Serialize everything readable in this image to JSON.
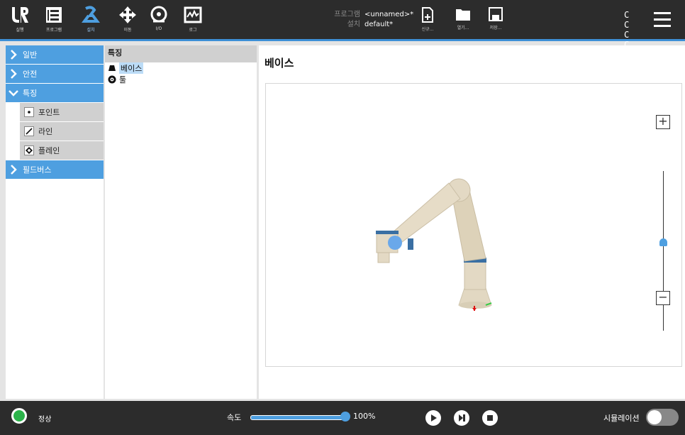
{
  "header": {
    "nav": [
      {
        "label": "실행",
        "icon": "ur-logo-icon"
      },
      {
        "label": "프로그램",
        "icon": "program-icon"
      },
      {
        "label": "설치",
        "icon": "installation-icon",
        "active": true
      },
      {
        "label": "이동",
        "icon": "move-icon"
      },
      {
        "label": "I/O",
        "icon": "io-icon"
      },
      {
        "label": "로그",
        "icon": "log-icon"
      }
    ],
    "program_key": "프로그램",
    "program_value": "<unnamed>*",
    "install_key": "설치",
    "install_value": "default*",
    "new_label": "신규...",
    "open_label": "열기...",
    "save_label": "저장...",
    "cc_top": "C C",
    "cc_bottom": "C C"
  },
  "sidebar": {
    "general": "일반",
    "safety": "안전",
    "features": "특징",
    "sub_items": [
      "포인트",
      "라인",
      "플레인"
    ],
    "fieldbus": "필드버스"
  },
  "tree": {
    "header": "특징",
    "items": [
      "베이스",
      "툴"
    ]
  },
  "main": {
    "title": "베이스",
    "zoom_in": "+",
    "zoom_out": "−",
    "zoom_level": 0.46
  },
  "footer": {
    "status": "정상",
    "speed_label": "속도",
    "speed_value": "100%",
    "simulation_label": "시뮬레이션",
    "simulation_on": false
  },
  "colors": {
    "accent": "#4e9fe0",
    "topbar": "#2c2c2c",
    "status_ok": "#2bb34a"
  }
}
